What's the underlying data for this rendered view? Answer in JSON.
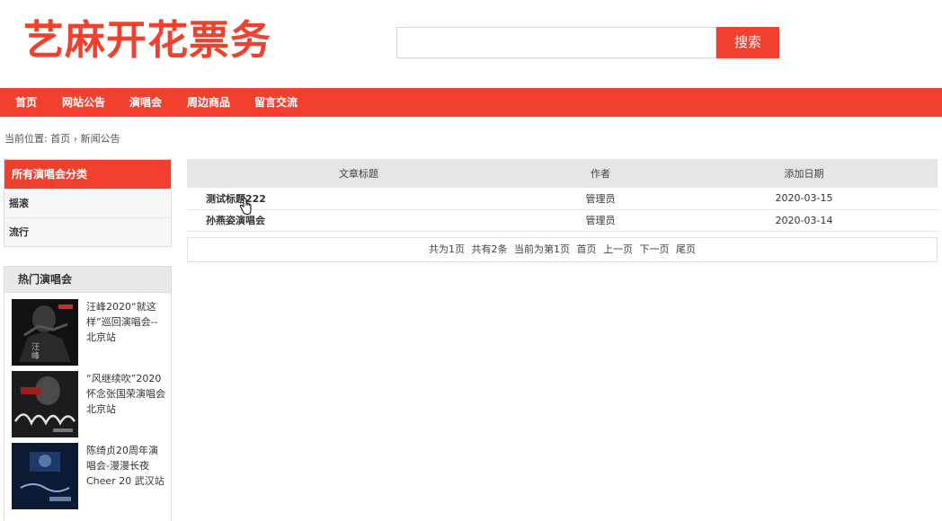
{
  "header": {
    "logo_text": "艺麻开花票务",
    "search_placeholder": "",
    "search_button": "搜索"
  },
  "nav": {
    "items": [
      "首页",
      "网站公告",
      "演唱会",
      "周边商品",
      "留言交流"
    ]
  },
  "breadcrumb": {
    "label": "当前位置: 首页",
    "separator": "›",
    "current": "新闻公告"
  },
  "sidebar": {
    "category_title": "所有演唱会分类",
    "categories": [
      "摇滚",
      "流行"
    ],
    "hot_title": "热门演唱会",
    "hot_items": [
      {
        "title": "汪峰2020“就这样”巡回演唱会--北京站"
      },
      {
        "title": "“风继续吹”2020怀念张国荣演唱会北京站"
      },
      {
        "title": "陈绮贞20周年演唱会-漫漫长夜Cheer 20 武汉站"
      }
    ]
  },
  "table": {
    "headers": [
      "文章标题",
      "作者",
      "添加日期"
    ],
    "rows": [
      {
        "title": "测试标题222",
        "author": "管理员",
        "date": "2020-03-15"
      },
      {
        "title": "孙燕姿演唱会",
        "author": "管理员",
        "date": "2020-03-14"
      }
    ]
  },
  "pager": {
    "total_pages": "共为1页",
    "total_items": "共有2条",
    "current_page": "当前为第1页",
    "first": "首页",
    "prev": "上一页",
    "next": "下一页",
    "last": "尾页"
  },
  "colors": {
    "accent": "#f2402f",
    "nav_bg": "#f2402f",
    "table_header_bg": "#e5e5e5"
  }
}
